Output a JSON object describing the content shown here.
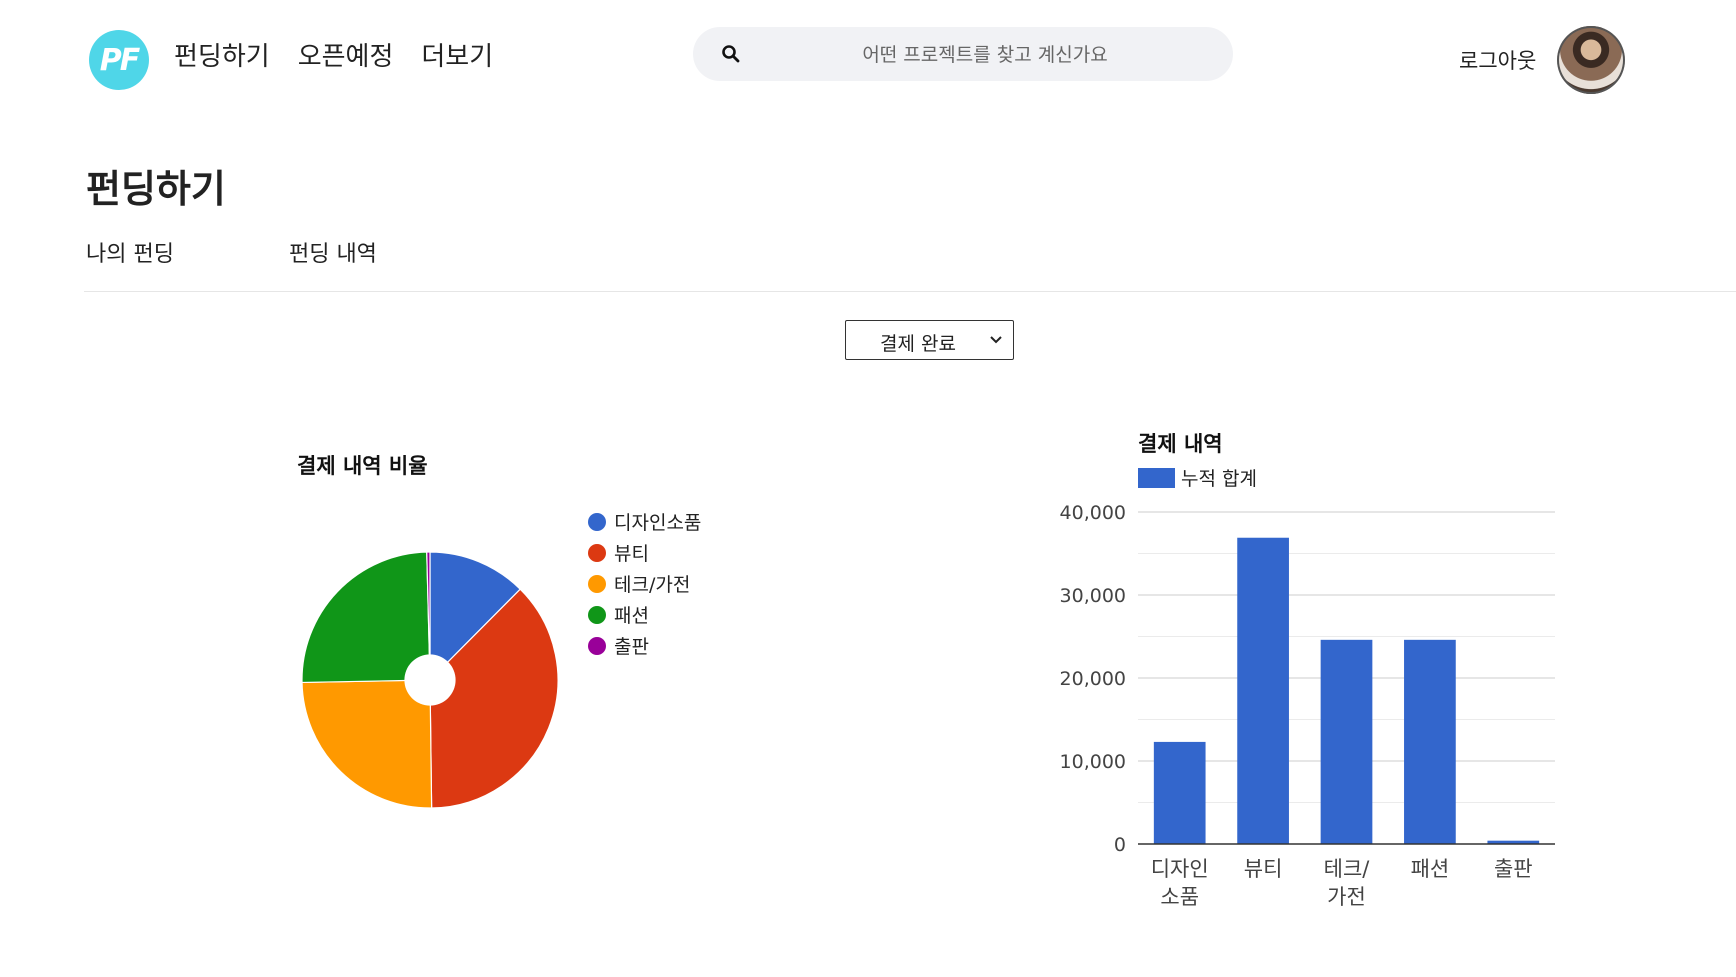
{
  "header": {
    "logo_text": "PF",
    "nav": [
      "펀딩하기",
      "오픈예정",
      "더보기"
    ],
    "search_placeholder": "어떤 프로젝트를 찾고 계신가요",
    "logout_label": "로그아웃"
  },
  "page": {
    "title": "펀딩하기",
    "tabs": [
      "나의 펀딩",
      "펀딩 내역"
    ]
  },
  "filter": {
    "selected": "결제 완료"
  },
  "icons": {
    "search": "search-icon",
    "dropdown": "chevron-down-icon"
  },
  "chart_data": [
    {
      "type": "pie",
      "title": "결제 내역 비율",
      "legend_position": "right",
      "categories": [
        "디자인소품",
        "뷰티",
        "테크/가전",
        "패션",
        "출판"
      ],
      "values": [
        12300,
        36900,
        24600,
        24600,
        400
      ],
      "colors": [
        "#3366cc",
        "#dc3912",
        "#ff9900",
        "#109618",
        "#990099"
      ],
      "hole": 0.2
    },
    {
      "type": "bar",
      "title": "결제 내역",
      "legend_position": "top",
      "categories": [
        "디자인소품",
        "뷰티",
        "테크/가전",
        "패션",
        "출판"
      ],
      "tick_labels": [
        [
          "디자인",
          "소품"
        ],
        [
          "뷰티"
        ],
        [
          "테크/",
          "가전"
        ],
        [
          "패션"
        ],
        [
          "출판"
        ]
      ],
      "series": [
        {
          "name": "누적 합계",
          "values": [
            12300,
            36900,
            24600,
            24600,
            400
          ],
          "color": "#3366cc"
        }
      ],
      "ylim": [
        0,
        40000
      ],
      "yticks": [
        0,
        10000,
        20000,
        30000,
        40000
      ],
      "ytick_labels": [
        "0",
        "10,000",
        "20,000",
        "30,000",
        "40,000"
      ],
      "grid": true
    }
  ]
}
